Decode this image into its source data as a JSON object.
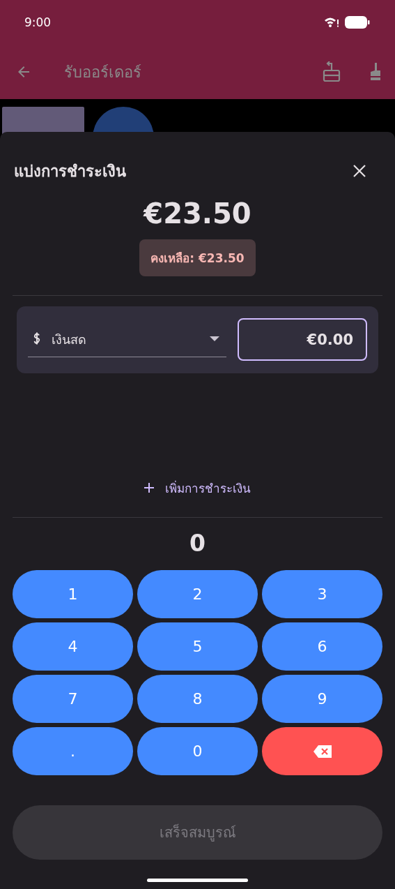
{
  "status_bar": {
    "time": "9:00"
  },
  "app_bar": {
    "title": "รับออร์เดอร์"
  },
  "sheet": {
    "title": "แบ่งการชำระเงิน",
    "total": "€23.50",
    "remaining": "คงเหลือ: €23.50",
    "payments": [
      {
        "method": "เงินสด",
        "amount": "€0.00",
        "focused": true
      }
    ],
    "add_payment": "เพิ่มการชำระเงิน",
    "display": "0",
    "keys": [
      {
        "kind": "digit",
        "label": "1"
      },
      {
        "kind": "digit",
        "label": "2"
      },
      {
        "kind": "digit",
        "label": "3"
      },
      {
        "kind": "digit",
        "label": "4"
      },
      {
        "kind": "digit",
        "label": "5"
      },
      {
        "kind": "digit",
        "label": "6"
      },
      {
        "kind": "digit",
        "label": "7"
      },
      {
        "kind": "digit",
        "label": "8"
      },
      {
        "kind": "digit",
        "label": "9"
      },
      {
        "kind": "digit",
        "label": "."
      },
      {
        "kind": "digit",
        "label": "0"
      },
      {
        "kind": "backspace"
      }
    ],
    "complete": {
      "label": "เสร็จสมบูรณ์",
      "disabled": true
    }
  }
}
